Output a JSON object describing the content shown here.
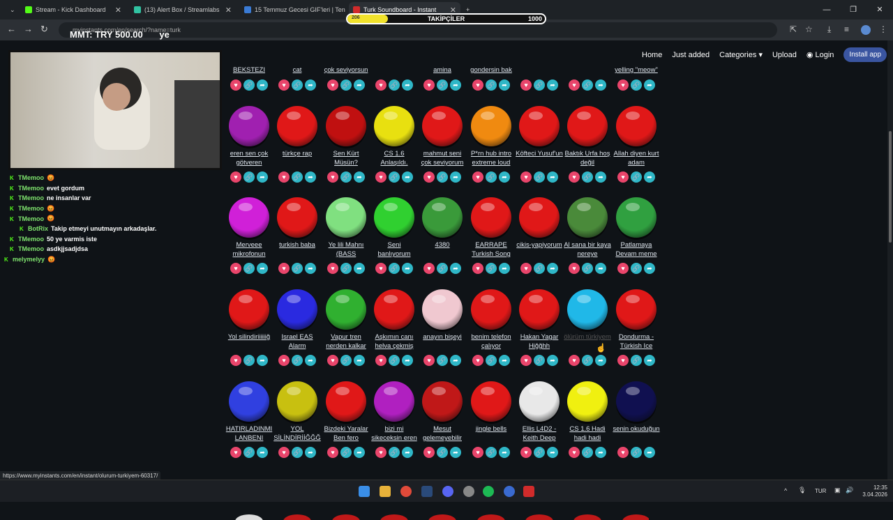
{
  "browser": {
    "tabs": [
      {
        "label": "Stream - Kick Dashboard",
        "color": "#53fc18"
      },
      {
        "label": "(13) Alert Box / Streamlabs",
        "color": "#31c3a2"
      },
      {
        "label": "15 Temmuz Gecesi GIF'leri | Ten",
        "color": "#3a7bd5"
      },
      {
        "label": "Turk Soundboard - Instant",
        "color": "#d12b2b"
      }
    ],
    "new_tab": "+",
    "url": "myinstants.com/en/search/?name=turk",
    "status_url": "https://www.myinstants.com/en/instant/olurum-turkiyem-60317/"
  },
  "overlay": {
    "money_text": "MT: TRY 500.00",
    "money_suffix": "ye",
    "follow_label": "TAKİPÇİLER",
    "follow_current": "206",
    "follow_goal": "1000",
    "follow_progress": 0.206
  },
  "site_nav": {
    "home": "Home",
    "just_added": "Just added",
    "categories": "Categories",
    "upload": "Upload",
    "login": "Login",
    "install": "Install app"
  },
  "top_row_labels": [
    "BEKSTEZI",
    "cat",
    "çok seviyorsun",
    "",
    "amina",
    "gondersin bak",
    "",
    "",
    "yelling \"meow\""
  ],
  "rows": [
    [
      {
        "label": "eren sen çok götveren",
        "color": "#a020b0"
      },
      {
        "label": "türkçe rap",
        "color": "#e01818"
      },
      {
        "label": "Sen Kürt Müsün?",
        "color": "#c01010"
      },
      {
        "label": "CS 1.6 Anlaşıldı.",
        "color": "#e8e010"
      },
      {
        "label": "mahmut seni çok seviyorum",
        "color": "#e01818"
      },
      {
        "label": "P*rn hub intro extreme loud",
        "color": "#f08a10"
      },
      {
        "label": "Köfteci Yusuf'un",
        "color": "#e01818"
      },
      {
        "label": "Baktık Urfa hoş değil",
        "color": "#e01818"
      },
      {
        "label": "Allah diyen kurt adam",
        "color": "#e01818"
      }
    ],
    [
      {
        "label": "Merveee mikrofonun",
        "color": "#d020d8"
      },
      {
        "label": "turkish baba",
        "color": "#e01818"
      },
      {
        "label": "Ye lili Mahnı (BASS",
        "color": "#80e080"
      },
      {
        "label": "Seni banlıyorum",
        "color": "#30d030"
      },
      {
        "label": "4380",
        "color": "#3a9a3a"
      },
      {
        "label": "EARRAPE Turkish Song",
        "color": "#e01818"
      },
      {
        "label": "cikis-yapiyorum",
        "color": "#e01818"
      },
      {
        "label": "Al sana bir kaya nereye",
        "color": "#4a8a3a"
      },
      {
        "label": "Patlamaya Devam meme",
        "color": "#30a040"
      }
    ],
    [
      {
        "label": "Yol silindiriiiiiiğ",
        "color": "#e01818"
      },
      {
        "label": "Israel EAS Alarm",
        "color": "#2a2ae0"
      },
      {
        "label": "Vapur tren nerden kalkar",
        "color": "#30b030"
      },
      {
        "label": "Aşkımın canı helva çekmiş",
        "color": "#e01818"
      },
      {
        "label": "anayın bişeyi",
        "color": "#f0c8d0"
      },
      {
        "label": "benim telefon çalıyor",
        "color": "#e01818"
      },
      {
        "label": "Hakan Yagar Hiğğhh",
        "color": "#e01818"
      },
      {
        "label": "ölürüm türkiyem",
        "color": "#20b8e8"
      },
      {
        "label": "Dondurma - Türkish Ice",
        "color": "#e01818"
      }
    ],
    [
      {
        "label": "HATIRLADINMI LANBENI",
        "color": "#3040e0"
      },
      {
        "label": "YOL SİLİNDİRİİĞĞĞ",
        "color": "#c8c010"
      },
      {
        "label": "Bizdeki Yaralar Ben fero",
        "color": "#e01818"
      },
      {
        "label": "bizi mi sikeceksin eren",
        "color": "#b020c0"
      },
      {
        "label": "Mesut gelemeyebilir",
        "color": "#c01818"
      },
      {
        "label": "jingle bells",
        "color": "#e01818"
      },
      {
        "label": "Ellis L4D2 - Keith Deep",
        "color": "#e8e8e8"
      },
      {
        "label": "CS 1.6 Hadi hadi hadi",
        "color": "#f0f010"
      },
      {
        "label": "senin okuduğun",
        "color": "#101050"
      }
    ]
  ],
  "actions": {
    "heart": "♥",
    "link": "🔗",
    "share": "➦"
  },
  "chat": [
    {
      "user": "TMemoo",
      "msg": "😡"
    },
    {
      "user": "TMemoo",
      "msg": "evet gordum"
    },
    {
      "user": "TMemoo",
      "msg": "ne insanlar var"
    },
    {
      "user": "TMemoo",
      "msg": "😡"
    },
    {
      "user": "TMemoo",
      "msg": "😡"
    },
    {
      "user": "BotRix",
      "msg": "Takip etmeyi unutmayın arkadaşlar."
    },
    {
      "user": "TMemoo",
      "msg": "50 ye varmis iste"
    },
    {
      "user": "TMemoo",
      "msg": "asdkjjsadjdsa"
    },
    {
      "user": "melymelyy",
      "msg": "😡"
    }
  ],
  "tray": {
    "lang": "TUR",
    "time": "12:35",
    "date": "3.04.2026"
  }
}
